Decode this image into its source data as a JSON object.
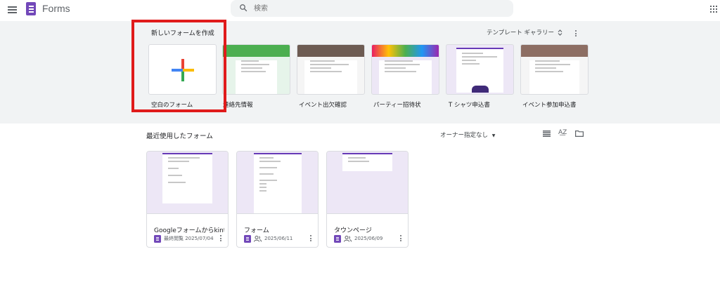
{
  "header": {
    "app_title": "Forms",
    "search_placeholder": "検索"
  },
  "template_gallery": {
    "title": "新しいフォームを作成",
    "gallery_link": "テンプレート ギャラリー",
    "templates": [
      {
        "label": "空白のフォーム"
      },
      {
        "label": "連絡先情報"
      },
      {
        "label": "イベント出欠確認"
      },
      {
        "label": "パーティー招待状"
      },
      {
        "label": "T シャツ申込書"
      },
      {
        "label": "イベント参加申込書"
      }
    ]
  },
  "recent": {
    "title": "最近使用したフォーム",
    "owner_filter": "オーナー指定なし",
    "forms": [
      {
        "title": "Googleフォームからkintone",
        "meta": "最終閲覧 2025/07/04",
        "shared": false
      },
      {
        "title": "フォーム",
        "meta": "2025/06/11",
        "shared": true
      },
      {
        "title": "タウンページ",
        "meta": "2025/06/09",
        "shared": true
      }
    ]
  },
  "colors": {
    "brand_purple": "#7248b9",
    "highlight_red": "#e01b1b",
    "gallery_bg": "#f1f3f4"
  },
  "icons": [
    "menu-icon",
    "forms-logo-icon",
    "search-icon",
    "apps-grid-icon",
    "sort-arrows-icon",
    "kebab-icon",
    "plus-icon",
    "list-view-icon",
    "sort-az-icon",
    "folder-icon",
    "shared-people-icon",
    "dropdown-arrow-icon"
  ]
}
